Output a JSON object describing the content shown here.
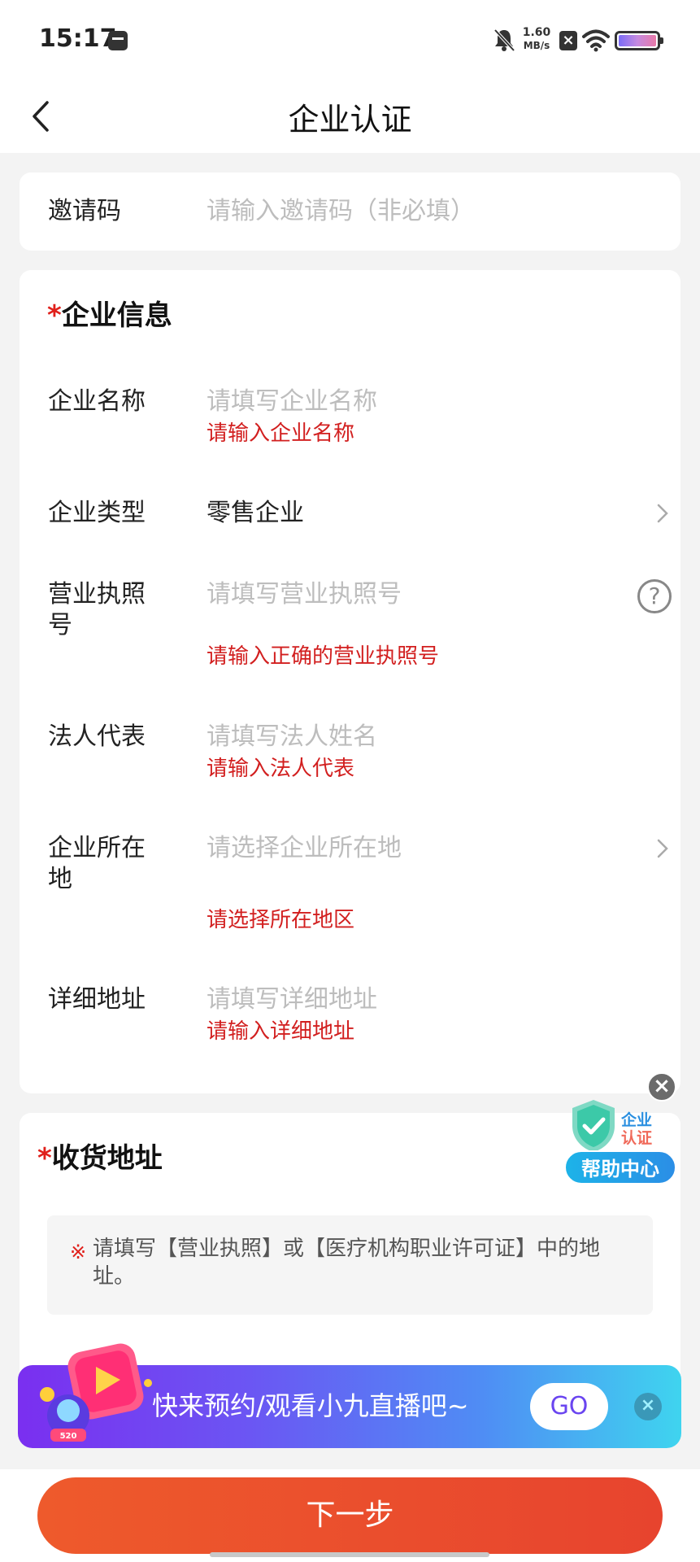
{
  "status_bar": {
    "time": "15:17",
    "net_speed_value": "1.60",
    "net_speed_unit": "MB/s"
  },
  "nav": {
    "title": "企业认证"
  },
  "invite": {
    "label": "邀请码",
    "placeholder": "请输入邀请码（非必填）"
  },
  "company": {
    "section_title": "企业信息",
    "required_mark": "*",
    "name": {
      "label": "企业名称",
      "placeholder": "请填写企业名称",
      "error": "请输入企业名称"
    },
    "type": {
      "label": "企业类型",
      "value": "零售企业"
    },
    "license": {
      "label_line1": "营业执照",
      "label_line2": "号",
      "placeholder": "请填写营业执照号",
      "error": "请输入正确的营业执照号",
      "help_glyph": "?"
    },
    "legal_rep": {
      "label": "法人代表",
      "placeholder": "请填写法人姓名",
      "error": "请输入法人代表"
    },
    "location": {
      "label_line1": "企业所在",
      "label_line2": "地",
      "placeholder": "请选择企业所在地",
      "error": "请选择所在地区"
    },
    "address": {
      "label": "详细地址",
      "placeholder": "请填写详细地址",
      "error": "请输入详细地址"
    }
  },
  "shipping": {
    "section_title": "收货地址",
    "required_mark": "*",
    "notice_mark": "※",
    "notice_text": "请填写【营业执照】或【医疗机构职业许可证】中的地址。"
  },
  "help_float": {
    "tag_line1": "企业",
    "tag_line2": "认证",
    "button": "帮助中心"
  },
  "banner": {
    "text": "快来预约/观看小九直播吧~",
    "go": "GO",
    "badge": "520"
  },
  "footer": {
    "next_button": "下一步"
  },
  "colors": {
    "accent_red": "#e0201b",
    "error_red": "#d21f1f",
    "button_orange": "#ee5a2c"
  }
}
